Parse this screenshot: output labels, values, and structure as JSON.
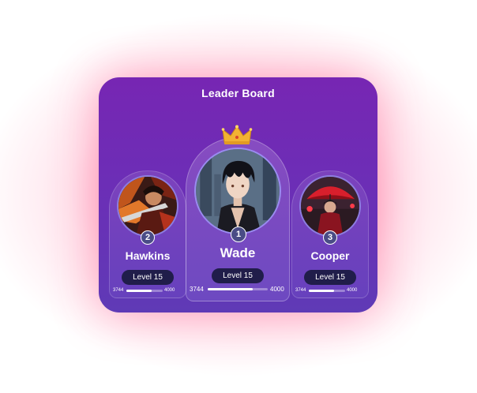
{
  "title": "Leader Board",
  "players": [
    {
      "id": "second",
      "rank": "2",
      "name": "Hawkins",
      "level": "Level 15",
      "xp_current": "3744",
      "xp_max": "4000",
      "progress": 0.7
    },
    {
      "id": "first",
      "rank": "1",
      "name": "Wade",
      "level": "Level 15",
      "xp_current": "3744",
      "xp_max": "4000",
      "progress": 0.75
    },
    {
      "id": "third",
      "rank": "3",
      "name": "Cooper",
      "level": "Level 15",
      "xp_current": "3744",
      "xp_max": "4000",
      "progress": 0.7
    }
  ],
  "colors": {
    "card_top": "#7726b3",
    "card_bottom": "#5f3ab6",
    "level_pill": "#201d4a",
    "crown": "#f2b233",
    "glow": "#ff9ebc"
  },
  "icons": {
    "crown": "crown-icon"
  }
}
